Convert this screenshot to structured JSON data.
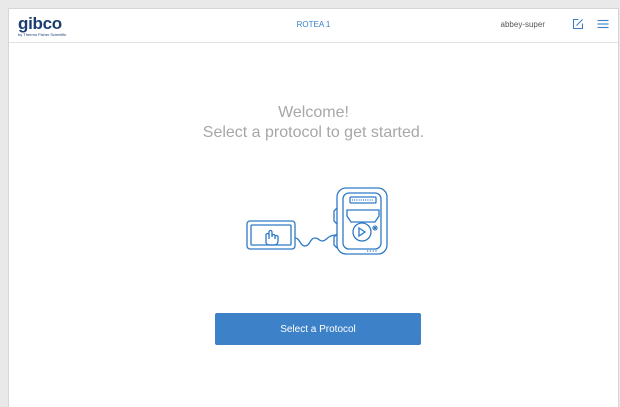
{
  "header": {
    "logo_text": "gibco",
    "logo_subtext": "by Thermo Fisher Scientific",
    "title": "ROTEA 1",
    "username": "abbey-super",
    "edit_icon": "edit-square-icon",
    "menu_icon": "hamburger-menu-icon"
  },
  "main": {
    "welcome_line1": "Welcome!",
    "welcome_line2": "Select a protocol to get started.",
    "illustration": "tablet-connected-to-rotea-device",
    "button_label": "Select a Protocol"
  },
  "colors": {
    "brand": "#1a3d74",
    "accent": "#3a7fc6",
    "button": "#3d82c9",
    "muted_text": "#a7a7a7"
  }
}
